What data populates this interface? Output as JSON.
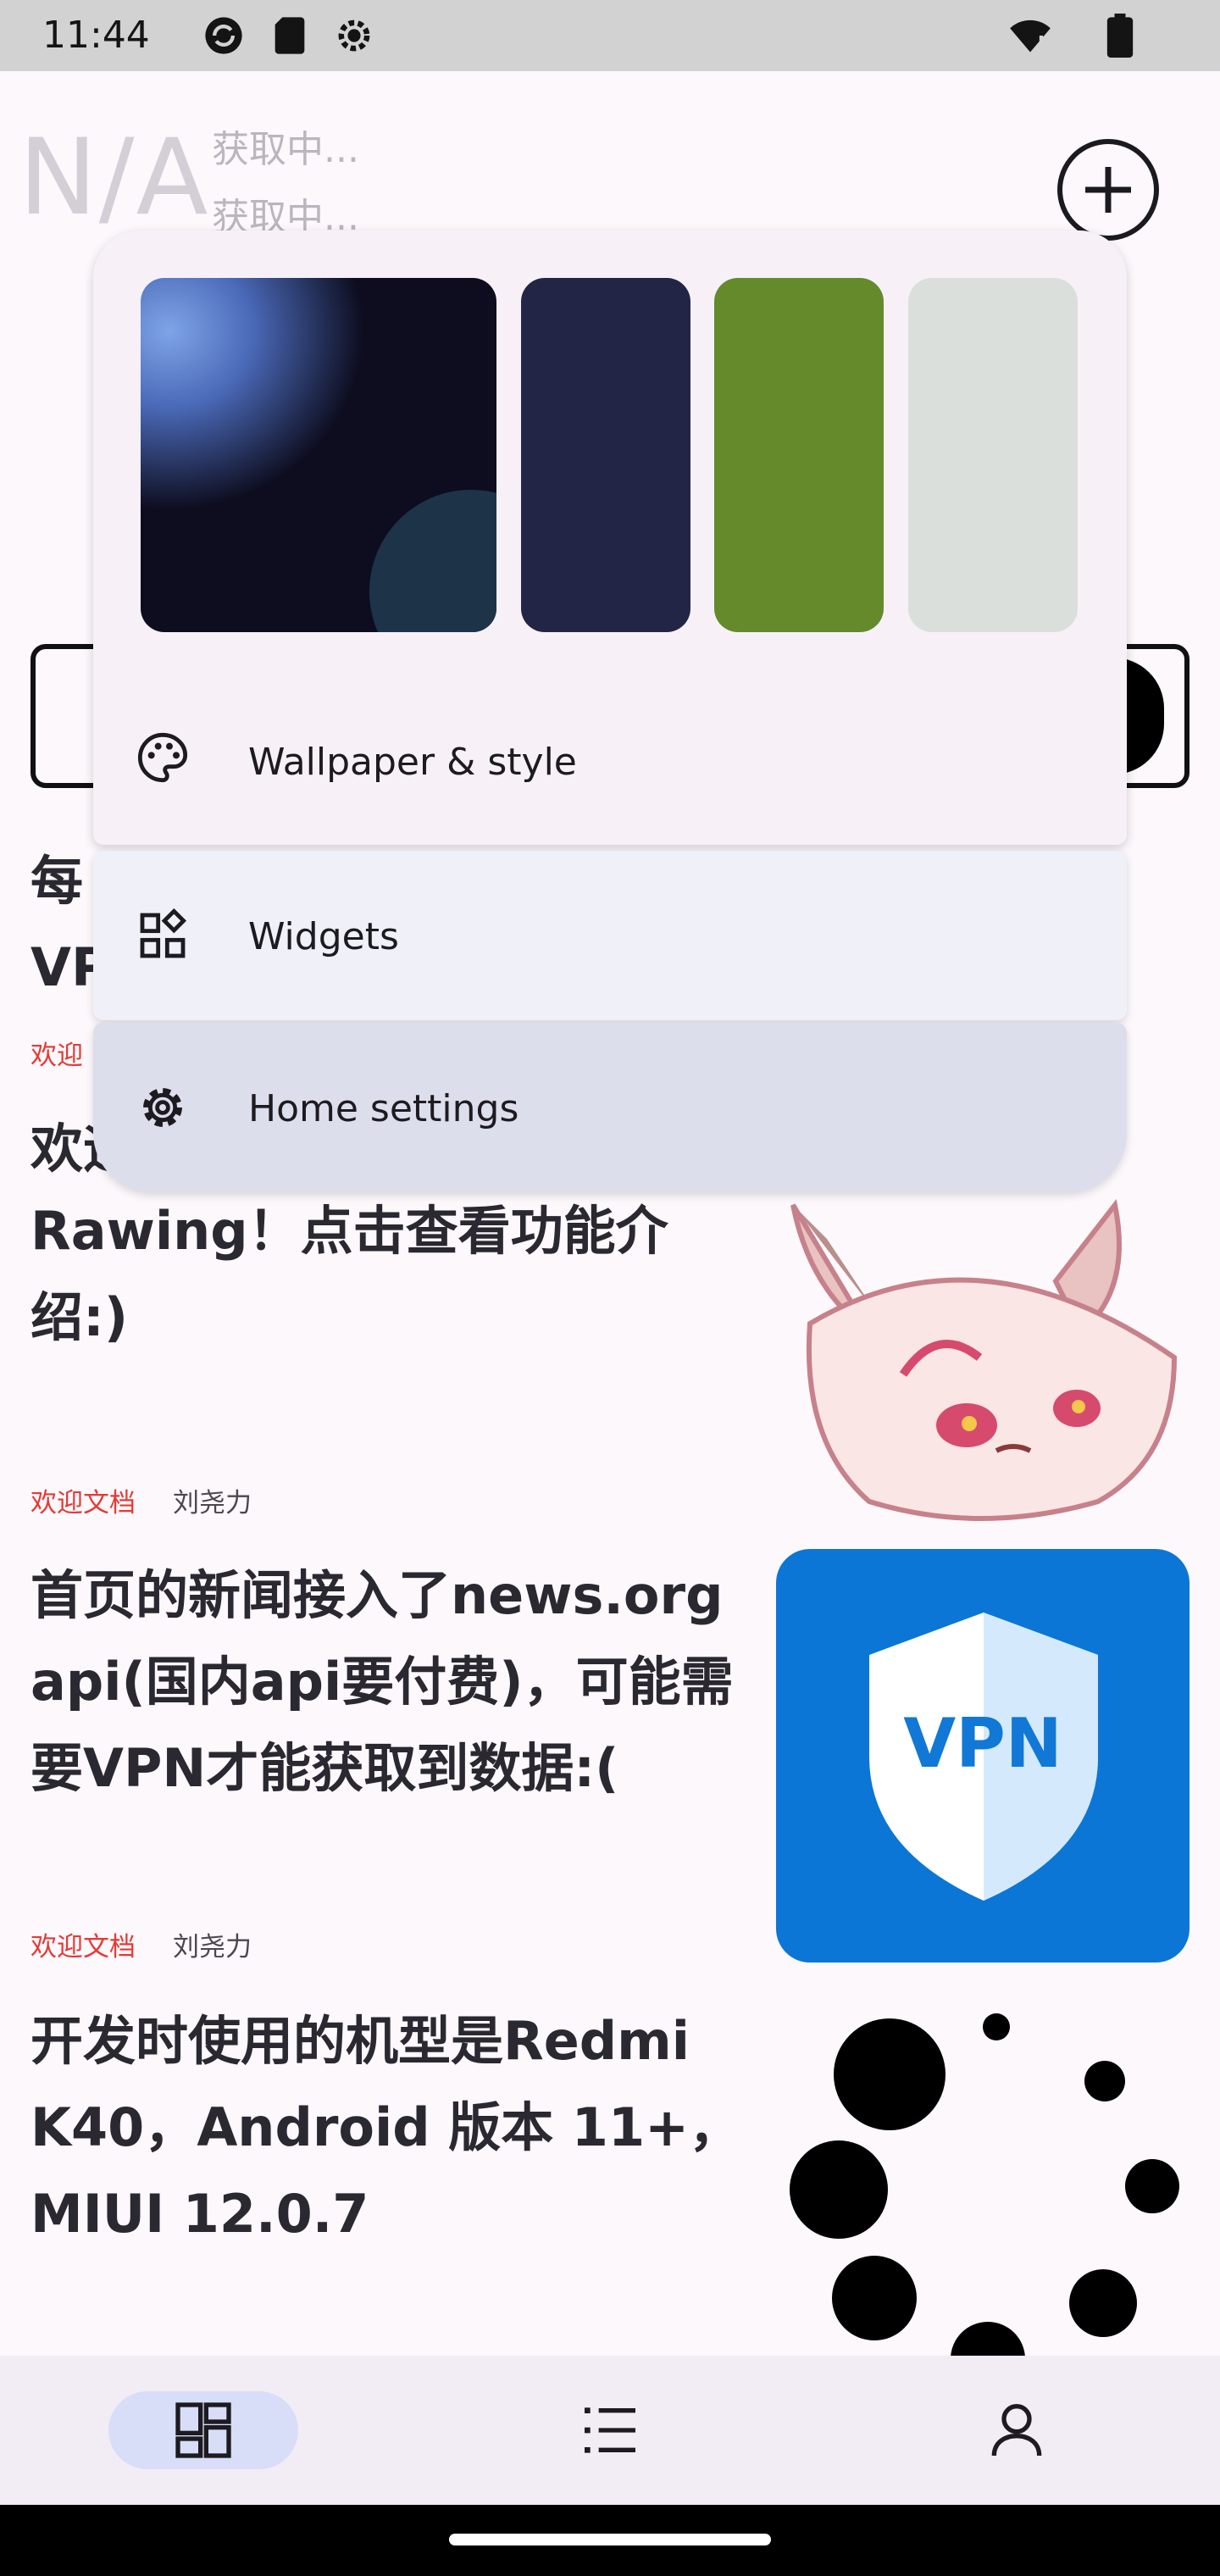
{
  "status_bar": {
    "time": "11:44",
    "left_icons": [
      "sync-icon",
      "sd-card-icon",
      "settings-icon"
    ],
    "right_icons": [
      "wifi-icon",
      "battery-icon"
    ]
  },
  "header": {
    "temperature": "N/A",
    "line1": "获取中...",
    "line2": "获取中...",
    "add_icon": "plus-circle-icon"
  },
  "popup": {
    "swatch_colors": [
      "#232546",
      "#648a2c",
      "#dbdfdb"
    ],
    "items": [
      {
        "label": "Wallpaper & style",
        "icon": "palette-icon"
      },
      {
        "label": "Widgets",
        "icon": "widgets-icon"
      },
      {
        "label": "Home settings",
        "icon": "gear-icon"
      }
    ]
  },
  "background": {
    "partial_head_1": "每",
    "partial_head_2": "VP",
    "partial_tag": "欢迎",
    "partial_head_3": "欢迎"
  },
  "articles": [
    {
      "title": "Rawing！点击查看功能介绍:)",
      "tag": "欢迎文档",
      "author": "刘尧力",
      "thumb": "anime-character"
    },
    {
      "title": "首页的新闻接入了news.org api(国内api要付费)，可能需要VPN才能获取到数据:(",
      "tag": "欢迎文档",
      "author": "刘尧力",
      "thumb": "vpn-shield",
      "thumb_text": "VPN"
    },
    {
      "title": "开发时使用的机型是Redmi K40，Android 版本 11+，MIUI 12.0.7",
      "thumb": "loading-dots"
    }
  ],
  "bottom_nav": [
    {
      "name": "dashboard-tab",
      "icon": "dashboard-icon",
      "active": true
    },
    {
      "name": "list-tab",
      "icon": "list-icon",
      "active": false
    },
    {
      "name": "profile-tab",
      "icon": "person-icon",
      "active": false
    }
  ],
  "colors": {
    "accent": "#d8def8",
    "tag_red": "#e53935",
    "vpn_blue": "#0b76d6"
  }
}
